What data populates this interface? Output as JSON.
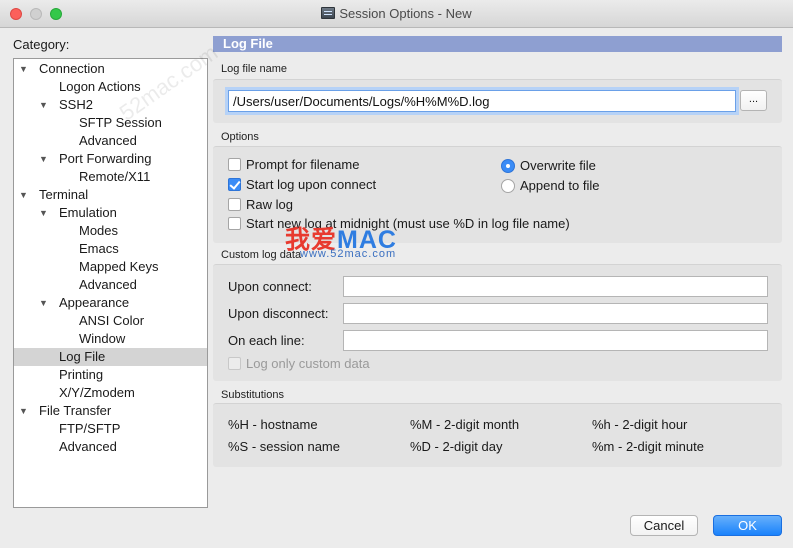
{
  "window": {
    "title": "Session Options - New"
  },
  "category": {
    "label": "Category:",
    "items": [
      {
        "label": "Connection",
        "level": 0,
        "expanded": true
      },
      {
        "label": "Logon Actions",
        "level": 1
      },
      {
        "label": "SSH2",
        "level": 1,
        "expanded": true
      },
      {
        "label": "SFTP Session",
        "level": 2
      },
      {
        "label": "Advanced",
        "level": 2
      },
      {
        "label": "Port Forwarding",
        "level": 1,
        "expanded": true
      },
      {
        "label": "Remote/X11",
        "level": 2
      },
      {
        "label": "Terminal",
        "level": 0,
        "expanded": true
      },
      {
        "label": "Emulation",
        "level": 1,
        "expanded": true
      },
      {
        "label": "Modes",
        "level": 2
      },
      {
        "label": "Emacs",
        "level": 2
      },
      {
        "label": "Mapped Keys",
        "level": 2
      },
      {
        "label": "Advanced",
        "level": 2
      },
      {
        "label": "Appearance",
        "level": 1,
        "expanded": true
      },
      {
        "label": "ANSI Color",
        "level": 2
      },
      {
        "label": "Window",
        "level": 2
      },
      {
        "label": "Log File",
        "level": 1,
        "selected": true
      },
      {
        "label": "Printing",
        "level": 1
      },
      {
        "label": "X/Y/Zmodem",
        "level": 1
      },
      {
        "label": "File Transfer",
        "level": 0,
        "expanded": true
      },
      {
        "label": "FTP/SFTP",
        "level": 1
      },
      {
        "label": "Advanced",
        "level": 1
      }
    ]
  },
  "panel": {
    "header": "Log File",
    "log_file_name": {
      "label": "Log file name",
      "value": "/Users/user/Documents/Logs/%H%M%D.log",
      "browse_label": "..."
    },
    "options": {
      "label": "Options",
      "checkboxes": [
        {
          "label": "Prompt for filename",
          "checked": false
        },
        {
          "label": "Start log upon connect",
          "checked": true
        },
        {
          "label": "Raw log",
          "checked": false
        },
        {
          "label": "Start new log at midnight (must use %D in log file name)",
          "checked": false
        }
      ],
      "radios": [
        {
          "label": "Overwrite file",
          "checked": true
        },
        {
          "label": "Append to file",
          "checked": false
        }
      ]
    },
    "custom_log_data": {
      "label": "Custom log data",
      "fields": [
        {
          "label": "Upon connect:",
          "value": ""
        },
        {
          "label": "Upon disconnect:",
          "value": ""
        },
        {
          "label": "On each line:",
          "value": ""
        }
      ],
      "log_only_custom": {
        "label": "Log only custom data",
        "checked": false,
        "disabled": true
      }
    },
    "substitutions": {
      "label": "Substitutions",
      "items": [
        "%H - hostname",
        "%M - 2-digit month",
        "%h - 2-digit hour",
        "%S - session name",
        "%D - 2-digit day",
        "%m - 2-digit minute"
      ]
    }
  },
  "buttons": {
    "cancel": "Cancel",
    "ok": "OK"
  },
  "watermark": {
    "logo_red": "我爱",
    "logo_blue": "MAC",
    "url": "www.52mac.com",
    "diag": "52mac.com"
  },
  "colors": {
    "header": "#8e9fd1",
    "accent": "#3b8cf6",
    "ok_button": "#1a82fb"
  }
}
